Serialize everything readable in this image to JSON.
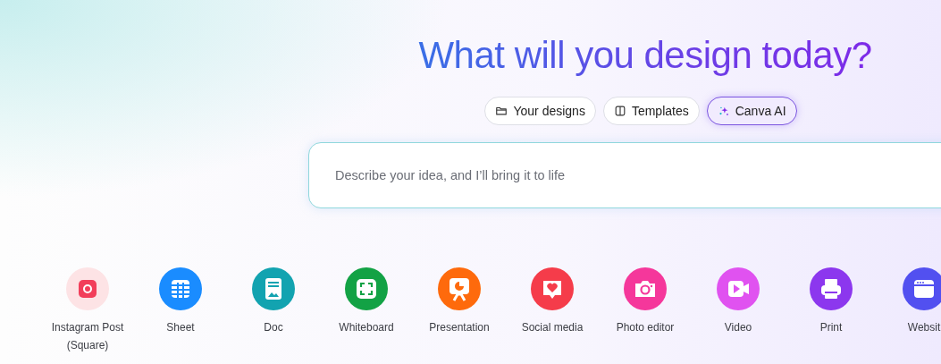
{
  "heading": "What will you design today?",
  "tabs": [
    {
      "label": "Your designs",
      "kind": "folder",
      "selected": false
    },
    {
      "label": "Templates",
      "kind": "template",
      "selected": false
    },
    {
      "label": "Canva AI",
      "kind": "sparkle",
      "selected": true
    }
  ],
  "prompt": {
    "placeholder": "Describe your idea, and I’ll bring it to life"
  },
  "shortcuts": [
    {
      "label": "Instagram Post (Square)",
      "kind": "instagram",
      "color": "#f23e5a"
    },
    {
      "label": "Sheet",
      "kind": "sheet",
      "color": "#1a8cff"
    },
    {
      "label": "Doc",
      "kind": "doc",
      "color": "#12a3b0"
    },
    {
      "label": "Whiteboard",
      "kind": "whiteboard",
      "color": "#13a245"
    },
    {
      "label": "Presentation",
      "kind": "presentation",
      "color": "#fe6a0c"
    },
    {
      "label": "Social media",
      "kind": "social",
      "color": "#f53c4a"
    },
    {
      "label": "Photo editor",
      "kind": "photo",
      "color": "#f5379b"
    },
    {
      "label": "Video",
      "kind": "video",
      "color": "#e052f0"
    },
    {
      "label": "Print",
      "kind": "print",
      "color": "#8c37ee"
    },
    {
      "label": "Websit",
      "kind": "website",
      "color": "#5250f0"
    }
  ]
}
